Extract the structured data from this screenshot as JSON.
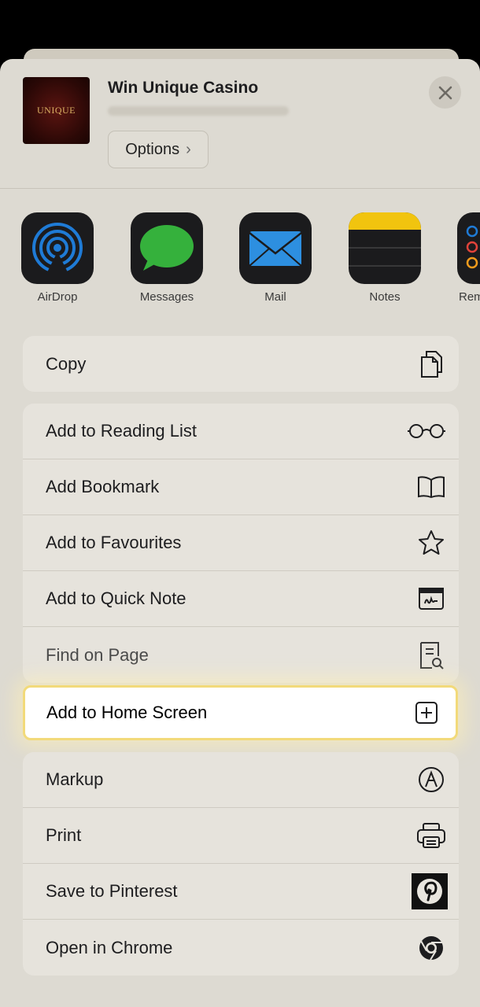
{
  "header": {
    "site_title": "Win Unique Casino",
    "thumbnail_logo_text": "UNIQUE",
    "options_label": "Options",
    "options_chevron": "›"
  },
  "apps": [
    {
      "label": "AirDrop",
      "icon": "airdrop-icon"
    },
    {
      "label": "Messages",
      "icon": "messages-icon"
    },
    {
      "label": "Mail",
      "icon": "mail-icon"
    },
    {
      "label": "Notes",
      "icon": "notes-icon"
    },
    {
      "label": "Rem",
      "icon": "reminders-icon"
    }
  ],
  "actions_copy": [
    {
      "label": "Copy",
      "icon": "copy-icon"
    }
  ],
  "actions_main": [
    {
      "label": "Add to Reading List",
      "icon": "glasses-icon"
    },
    {
      "label": "Add Bookmark",
      "icon": "book-icon"
    },
    {
      "label": "Add to Favourites",
      "icon": "star-icon"
    },
    {
      "label": "Add to Quick Note",
      "icon": "quick-note-icon"
    },
    {
      "label": "Find on Page",
      "icon": "find-on-page-icon"
    }
  ],
  "highlighted_action": {
    "label": "Add to Home Screen",
    "icon": "add-square-icon"
  },
  "actions_more": [
    {
      "label": "Markup",
      "icon": "markup-icon"
    },
    {
      "label": "Print",
      "icon": "print-icon"
    },
    {
      "label": "Save to Pinterest",
      "icon": "pinterest-icon"
    },
    {
      "label": "Open in Chrome",
      "icon": "chrome-icon"
    }
  ],
  "colors": {
    "sheet_background": "#dddad2",
    "highlight_border": "#f2da7a",
    "airdrop_blue": "#1f7bd6",
    "messages_green": "#35b13c",
    "mail_blue": "#2d8fe0",
    "notes_yellow": "#f1c40f"
  }
}
